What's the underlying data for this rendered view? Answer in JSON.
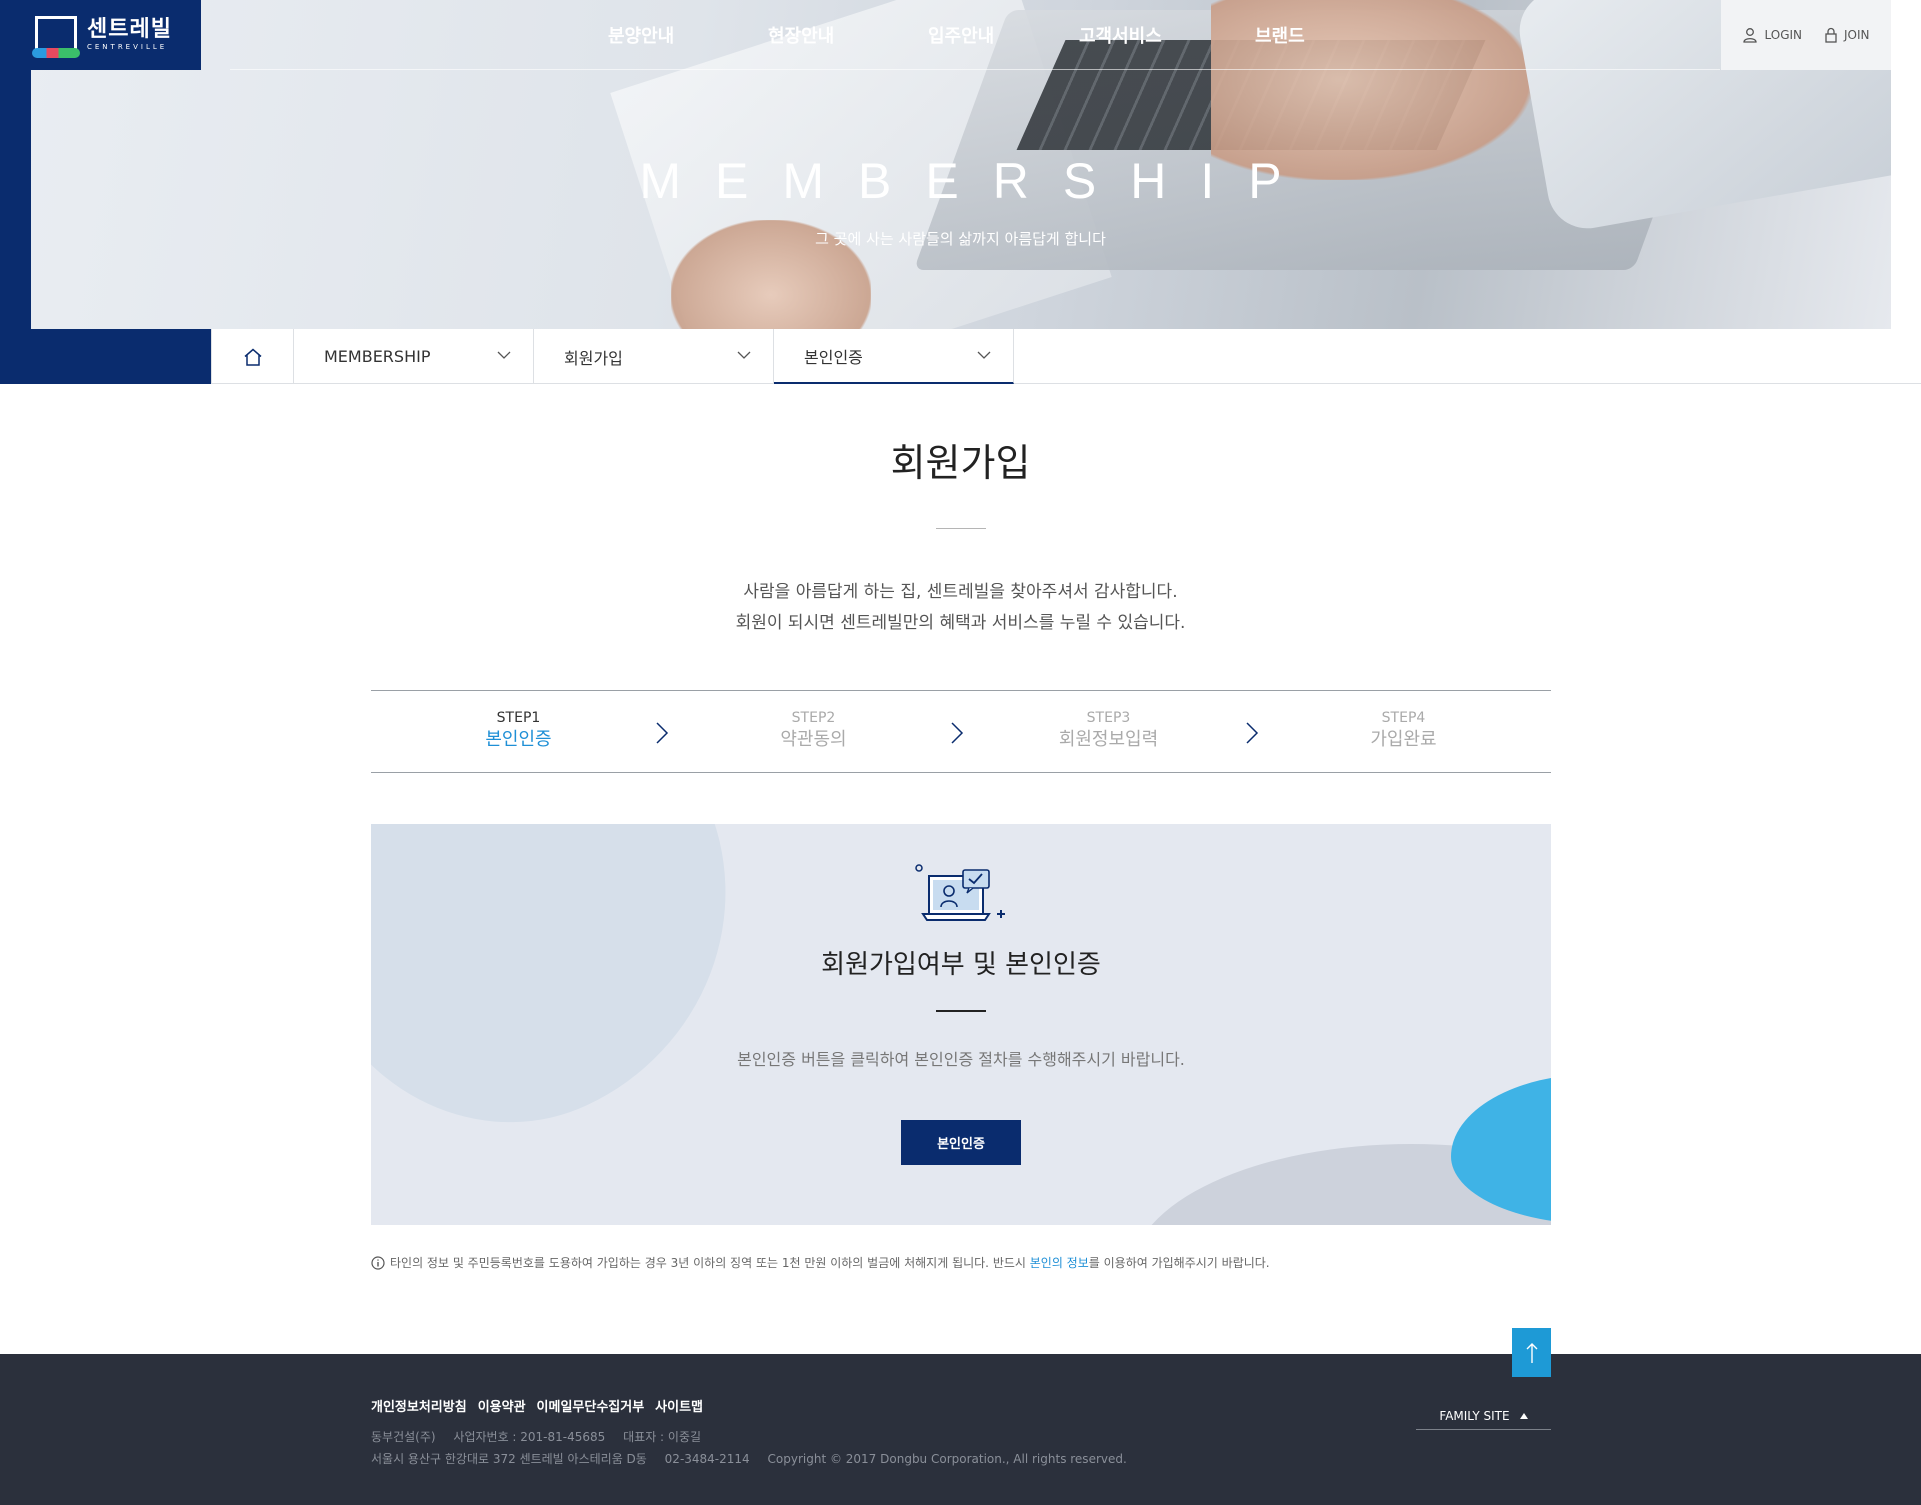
{
  "brand": {
    "name_ko": "센트레빌",
    "name_en": "CENTREVILLE"
  },
  "gnb": {
    "items": [
      {
        "label": "분양안내"
      },
      {
        "label": "현장안내"
      },
      {
        "label": "입주안내"
      },
      {
        "label": "고객서비스"
      },
      {
        "label": "브랜드"
      }
    ]
  },
  "util": {
    "login": "LOGIN",
    "join": "JOIN"
  },
  "hero": {
    "title": "MEMBERSHIP",
    "subtitle": "그 곳에 사는 사람들의 삶까지 아름답게 합니다"
  },
  "subnav": {
    "depth1": "MEMBERSHIP",
    "depth2": "회원가입",
    "depth3": "본인인증"
  },
  "main": {
    "title": "회원가입",
    "intro_line1": "사람을 아름답게 하는 집, 센트레빌을 찾아주셔서 감사합니다.",
    "intro_line2": "회원이 되시면 센트레빌만의 혜택과 서비스를 누릴 수 있습니다."
  },
  "steps": [
    {
      "num": "STEP1",
      "label": "본인인증",
      "current": true
    },
    {
      "num": "STEP2",
      "label": "약관동의",
      "current": false
    },
    {
      "num": "STEP3",
      "label": "회원정보입력",
      "current": false
    },
    {
      "num": "STEP4",
      "label": "가입완료",
      "current": false
    }
  ],
  "auth": {
    "title": "회원가입여부 및 본인인증",
    "description": "본인인증 버튼을 클릭하여 본인인증 절차를 수행해주시기 바랍니다.",
    "button": "본인인증"
  },
  "notice": {
    "text_before": "타인의 정보 및 주민등록번호를 도용하여 가입하는 경우 3년 이하의 징역 또는 1천 만원 이하의 벌금에 처해지게 됩니다. 반드시 ",
    "highlight": "본인의 정보",
    "text_after": "를 이용하여 가입해주시기 바랍니다."
  },
  "footer": {
    "links": [
      "개인정보처리방침",
      "이용약관",
      "이메일무단수집거부",
      "사이트맵"
    ],
    "company": "동부건설(주)",
    "biz_no": "사업자번호 : 201-81-45685",
    "ceo": "대표자 : 이중길",
    "address": "서울시 용산구 한강대로 372 센트레빌 아스테리움 D동",
    "phone": "02-3484-2114",
    "copyright": "Copyright © 2017 Dongbu Corporation., All rights reserved.",
    "family_site": "FAMILY SITE"
  },
  "colors": {
    "navy": "#0a2c6e",
    "accent_blue": "#1e8fd6",
    "footer_bg": "#2b303c",
    "panel_bg": "#e4e8f0"
  }
}
